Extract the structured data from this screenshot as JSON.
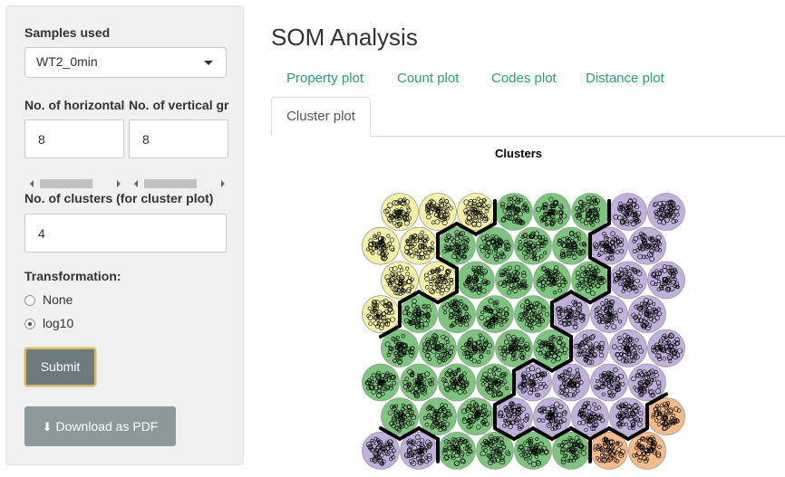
{
  "sidebar": {
    "samples_label": "Samples used",
    "samples_value": "WT2_0min",
    "horizontal_label": "No. of horizontal",
    "vertical_label": "No. of vertical gr",
    "horizontal_value": "8",
    "vertical_value": "8",
    "clusters_label": "No. of clusters (for cluster plot)",
    "clusters_value": "4",
    "transformation_label": "Transformation:",
    "options": [
      "None",
      "log10"
    ],
    "selected_option": "log10",
    "submit_label": "Submit",
    "download_label": "Download as PDF"
  },
  "main": {
    "title": "SOM Analysis",
    "tabs": [
      "Property plot",
      "Count plot",
      "Codes plot",
      "Distance plot",
      "Cluster plot"
    ],
    "active_tab": "Cluster plot",
    "plot_title": "Clusters"
  },
  "colors": {
    "accent_tab_text": "#2aa080",
    "cluster_yellow": "#f4f0a8",
    "cluster_green": "#7dc57d",
    "cluster_purple": "#bfb0dc",
    "cluster_orange": "#f4ba8a"
  },
  "som_grid": {
    "rows": 8,
    "cols": 8,
    "clusters": [
      [
        "purple",
        "purple",
        "green",
        "green",
        "green",
        "green",
        "orange",
        "orange"
      ],
      [
        "green",
        "green",
        "green",
        "purple",
        "purple",
        "purple",
        "purple",
        "orange"
      ],
      [
        "green",
        "green",
        "green",
        "green",
        "purple",
        "purple",
        "purple",
        "purple"
      ],
      [
        "green",
        "green",
        "green",
        "green",
        "green",
        "purple",
        "purple",
        "purple"
      ],
      [
        "yellow",
        "green",
        "green",
        "green",
        "green",
        "purple",
        "purple",
        "purple"
      ],
      [
        "yellow",
        "yellow",
        "green",
        "green",
        "green",
        "green",
        "purple",
        "purple"
      ],
      [
        "yellow",
        "yellow",
        "green",
        "green",
        "green",
        "green",
        "purple",
        "purple"
      ],
      [
        "yellow",
        "yellow",
        "yellow",
        "green",
        "green",
        "green",
        "purple",
        "purple"
      ]
    ]
  }
}
